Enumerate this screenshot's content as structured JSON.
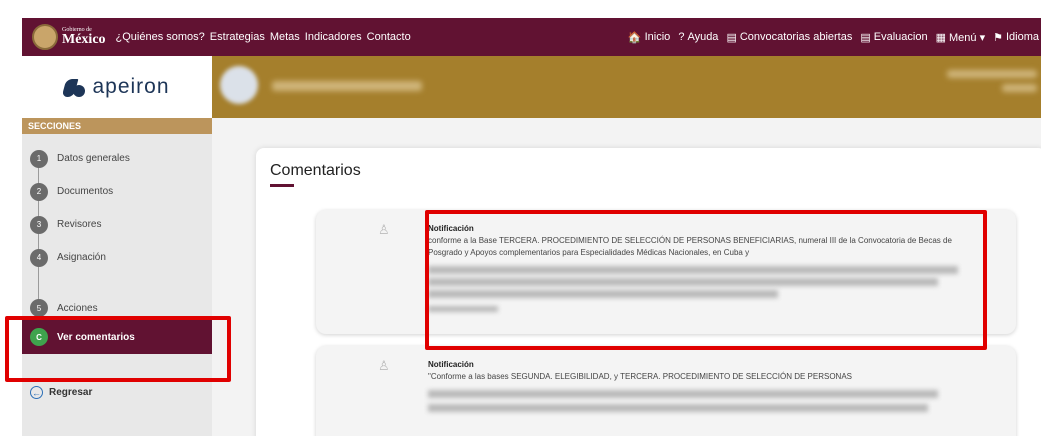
{
  "gov": {
    "logo_small": "Gobierno de",
    "logo_big": "México",
    "nav": [
      "¿Quiénes somos?",
      "Estrategias",
      "Metas",
      "Indicadores",
      "Contacto"
    ],
    "right": [
      {
        "icon": "home-icon",
        "glyph": "🏠",
        "label": "Inicio"
      },
      {
        "icon": "help-icon",
        "glyph": "?",
        "label": "Ayuda"
      },
      {
        "icon": "book-icon",
        "glyph": "▤",
        "label": "Convocatorias abiertas"
      },
      {
        "icon": "book-icon",
        "glyph": "▤",
        "label": "Evaluacion"
      },
      {
        "icon": "menu-icon",
        "glyph": "▦",
        "label": "Menú ▾"
      },
      {
        "icon": "flag-icon",
        "glyph": "⚑",
        "label": "Idioma"
      }
    ]
  },
  "sidebar": {
    "brand": "apeiron",
    "sections_label": "SECCIONES",
    "steps": [
      {
        "num": "1",
        "label": "Datos generales"
      },
      {
        "num": "2",
        "label": "Documentos"
      },
      {
        "num": "3",
        "label": "Revisores"
      },
      {
        "num": "4",
        "label": "Asignación"
      },
      {
        "num": "5",
        "label": "Acciones"
      }
    ],
    "active": {
      "num": "C",
      "label": "Ver comentarios"
    },
    "back_label": "Regresar"
  },
  "main": {
    "title": "Comentarios",
    "cards": [
      {
        "title": "Notificación",
        "body": "conforme a la Base TERCERA. PROCEDIMIENTO DE SELECCIÓN DE PERSONAS BENEFICIARIAS, numeral III de la Convocatoria de Becas de Posgrado y Apoyos complementarios para Especialidades Médicas Nacionales, en Cuba y"
      },
      {
        "title": "Notificación",
        "body": "\"Conforme a las bases SEGUNDA. ELEGIBILIDAD, y TERCERA. PROCEDIMIENTO DE SELECCIÓN DE PERSONAS"
      }
    ]
  },
  "colors": {
    "guinda": "#611232",
    "gold": "#a57f2c",
    "highlight": "#e00000"
  }
}
